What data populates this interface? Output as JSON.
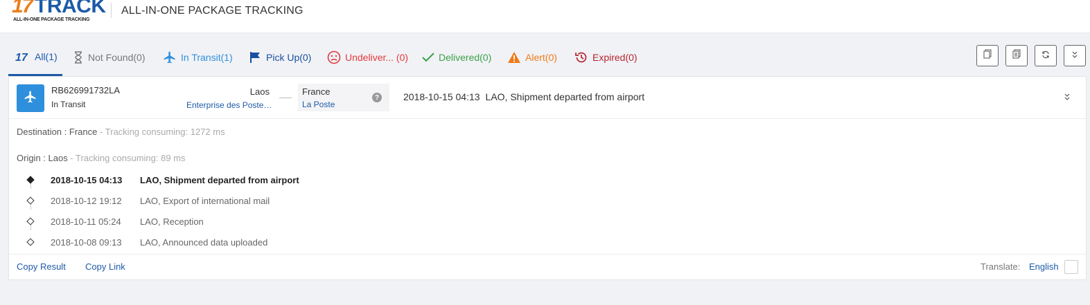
{
  "header": {
    "logo_number": "17",
    "logo_word": "TRACK",
    "logo_tagline": "ALL-IN-ONE PACKAGE TRACKING",
    "title": "ALL-IN-ONE PACKAGE TRACKING"
  },
  "tabs": [
    {
      "label": "All(1)",
      "icon": "17-logo-icon",
      "color": "#1c5aa8",
      "active": true
    },
    {
      "label": "Not Found(0)",
      "icon": "hourglass-icon",
      "color": "#777777"
    },
    {
      "label": "In Transit(1)",
      "icon": "airplane-icon",
      "color": "#2e8fdc"
    },
    {
      "label": "Pick Up(0)",
      "icon": "flag-icon",
      "color": "#1a4fa0"
    },
    {
      "label": "Undeliver... (0)",
      "icon": "sad-face-icon",
      "color": "#e23a3a"
    },
    {
      "label": "Delivered(0)",
      "icon": "checkmark-icon",
      "color": "#3aa04a"
    },
    {
      "label": "Alert(0)",
      "icon": "warning-icon",
      "color": "#f07a18"
    },
    {
      "label": "Expired(0)",
      "icon": "history-icon",
      "color": "#b5252e"
    }
  ],
  "toolbar": [
    {
      "icon": "copy-icon"
    },
    {
      "icon": "copy-all-icon"
    },
    {
      "icon": "refresh-icon"
    },
    {
      "icon": "collapse-icon"
    }
  ],
  "package": {
    "number": "RB626991732LA",
    "status": "In Transit",
    "origin_country": "Laos",
    "origin_carrier": "Enterprise des Poste …",
    "dest_country": "France",
    "dest_carrier": "La Poste",
    "latest_time": "2018-10-15 04:13",
    "latest_desc": "LAO, Shipment departed from airport"
  },
  "destination_info": {
    "label": "Destination : France",
    "consuming": " - Tracking consuming: 1272 ms"
  },
  "origin_info": {
    "label": "Origin : Laos",
    "consuming": " - Tracking consuming: 89 ms"
  },
  "events": [
    {
      "time": "2018-10-15 04:13",
      "desc": "LAO, Shipment departed from airport"
    },
    {
      "time": "2018-10-12 19:12",
      "desc": "LAO, Export of international mail"
    },
    {
      "time": "2018-10-11 05:24",
      "desc": "LAO, Reception"
    },
    {
      "time": "2018-10-08 09:13",
      "desc": "LAO, Announced data uploaded"
    }
  ],
  "footer": {
    "copy_result": "Copy Result",
    "copy_link": "Copy Link",
    "translate_label": "Translate:",
    "translate_lang": "English"
  },
  "colors": {
    "brand_blue": "#1c5aa8",
    "brand_orange": "#ec7e1d",
    "transit_blue": "#2e8fdc"
  }
}
